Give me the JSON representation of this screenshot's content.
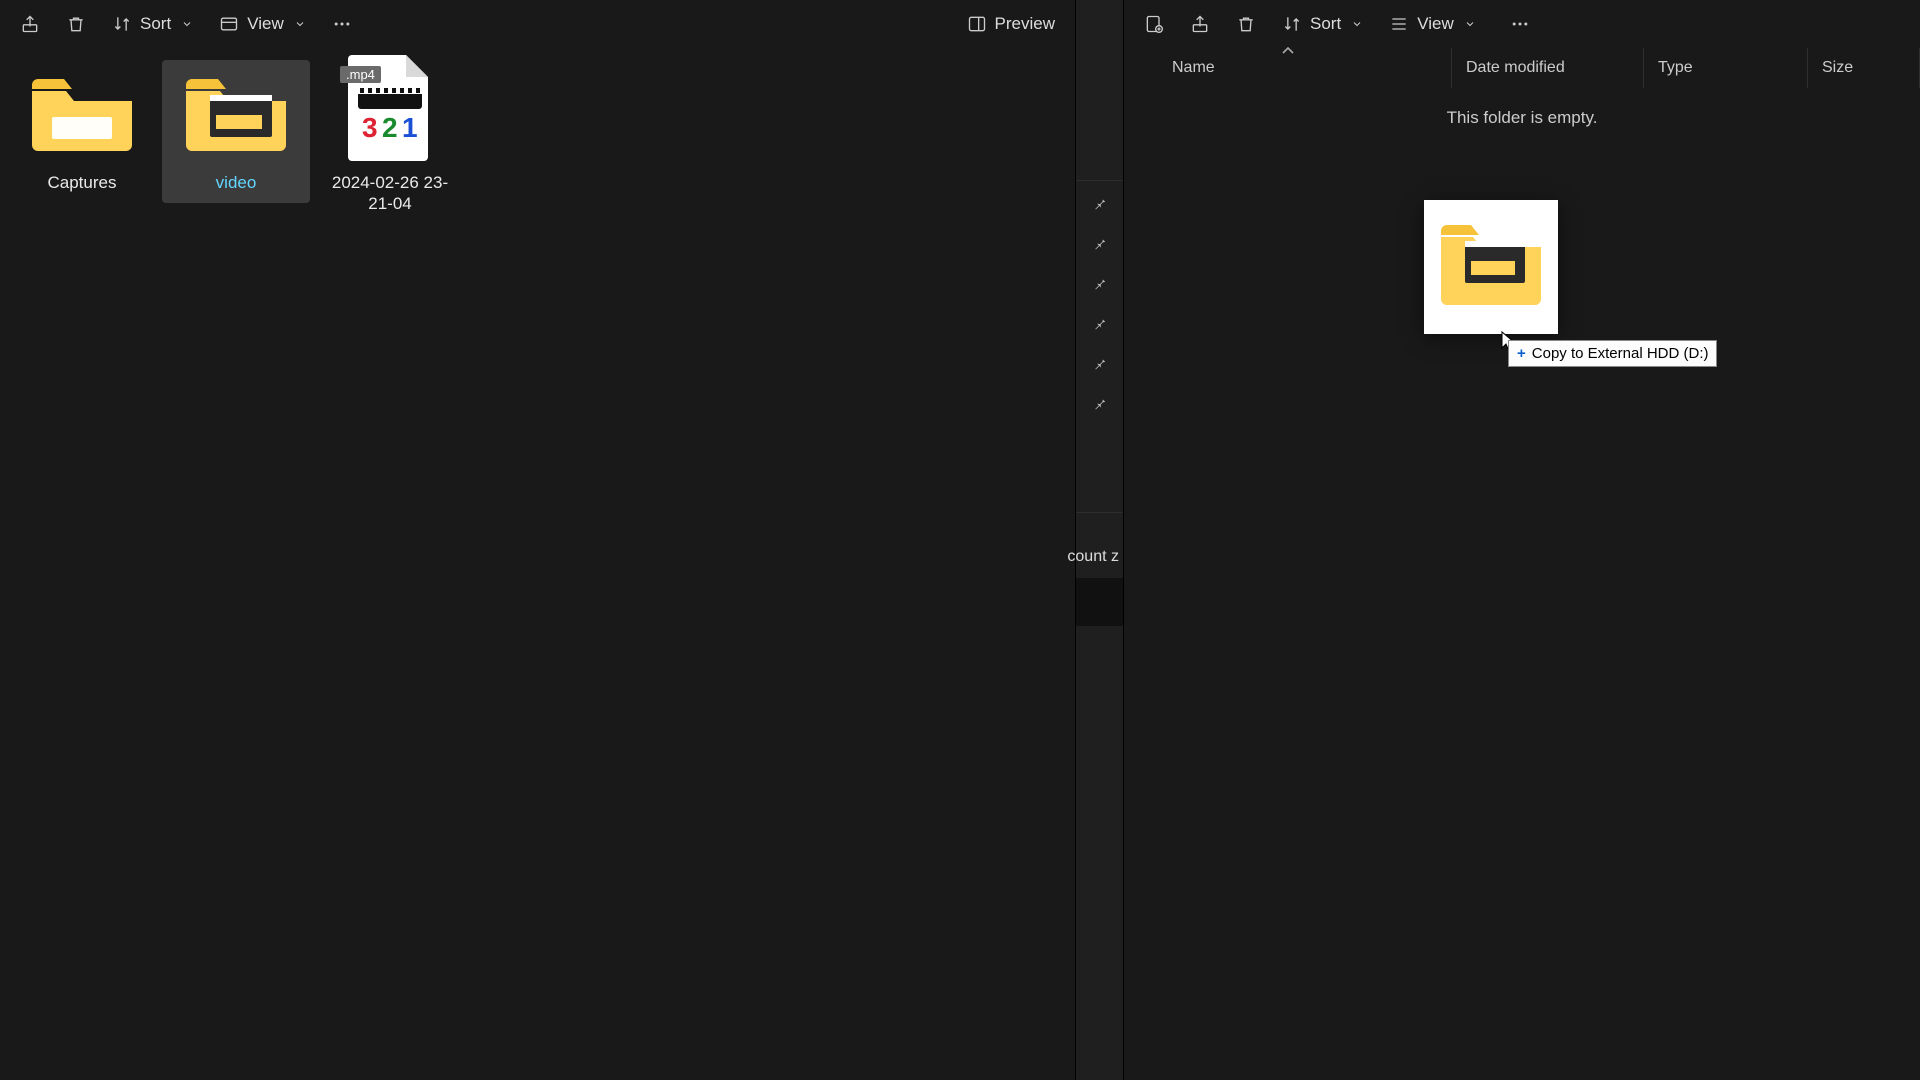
{
  "left": {
    "toolbar": {
      "sort": "Sort",
      "view": "View",
      "preview": "Preview"
    },
    "items": [
      {
        "name": "Captures",
        "type": "folder"
      },
      {
        "name": "video",
        "type": "folder-thumb",
        "selected": true
      },
      {
        "name": "2024-02-26 23-21-04",
        "type": "mp4",
        "ext": ".mp4"
      }
    ]
  },
  "right": {
    "toolbar": {
      "sort": "Sort",
      "view": "View"
    },
    "columns": {
      "name": "Name",
      "date": "Date modified",
      "type": "Type",
      "size": "Size"
    },
    "empty": "This folder is empty."
  },
  "drag": {
    "tooltip": "Copy to External HDD (D:)"
  },
  "nav": {
    "truncated": "count z"
  }
}
